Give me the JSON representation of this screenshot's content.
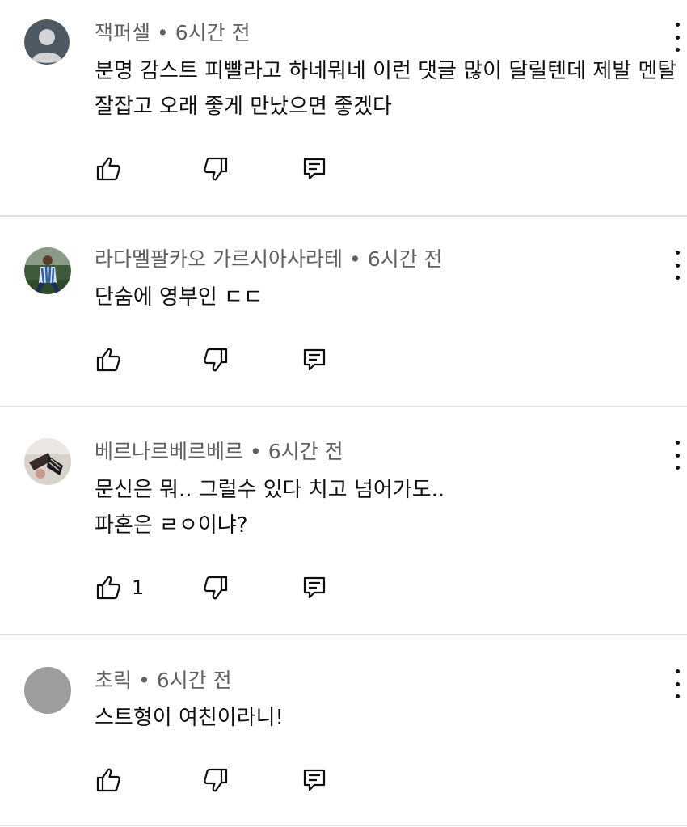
{
  "comments": [
    {
      "author": "잭퍼셀",
      "time": "6시간 전",
      "lines": [
        "분명 감스트 피빨라고 하네뭐네 이런 댓글 많이 달릴텐데 제발 멘탈",
        "잘잡고 오래 좋게 만났으면 좋겠다"
      ],
      "likes": "",
      "avatar": "default-avatar-icon"
    },
    {
      "author": "라다멜팔카오 가르시아사라테",
      "time": "6시간 전",
      "lines": [
        "단숨에 영부인 ㄷㄷ"
      ],
      "likes": "",
      "avatar": "soccer-player-photo"
    },
    {
      "author": "베르나르베르베르",
      "time": "6시간 전",
      "lines": [
        "문신은 뭐.. 그럴수 있다 치고 넘어가도..",
        "파혼은 ㄹㅇ이냐?"
      ],
      "likes": "1",
      "avatar": "photo"
    },
    {
      "author": "초릭",
      "time": "6시간 전",
      "lines": [
        "스트형이 여친이라니!"
      ],
      "likes": "",
      "avatar": "gray-circle"
    }
  ],
  "separator": "•",
  "colors": {
    "meta": "#606060",
    "text": "#0f0f0f",
    "divider": "#e2e2e2"
  }
}
